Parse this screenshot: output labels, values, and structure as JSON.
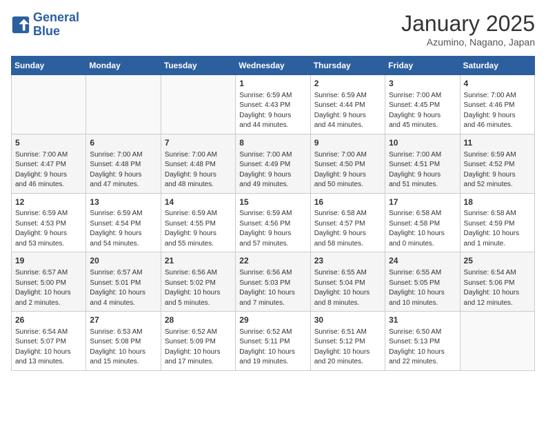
{
  "logo": {
    "line1": "General",
    "line2": "Blue"
  },
  "title": "January 2025",
  "subtitle": "Azumino, Nagano, Japan",
  "days_of_week": [
    "Sunday",
    "Monday",
    "Tuesday",
    "Wednesday",
    "Thursday",
    "Friday",
    "Saturday"
  ],
  "weeks": [
    [
      {
        "day": "",
        "info": ""
      },
      {
        "day": "",
        "info": ""
      },
      {
        "day": "",
        "info": ""
      },
      {
        "day": "1",
        "info": "Sunrise: 6:59 AM\nSunset: 4:43 PM\nDaylight: 9 hours\nand 44 minutes."
      },
      {
        "day": "2",
        "info": "Sunrise: 6:59 AM\nSunset: 4:44 PM\nDaylight: 9 hours\nand 44 minutes."
      },
      {
        "day": "3",
        "info": "Sunrise: 7:00 AM\nSunset: 4:45 PM\nDaylight: 9 hours\nand 45 minutes."
      },
      {
        "day": "4",
        "info": "Sunrise: 7:00 AM\nSunset: 4:46 PM\nDaylight: 9 hours\nand 46 minutes."
      }
    ],
    [
      {
        "day": "5",
        "info": "Sunrise: 7:00 AM\nSunset: 4:47 PM\nDaylight: 9 hours\nand 46 minutes."
      },
      {
        "day": "6",
        "info": "Sunrise: 7:00 AM\nSunset: 4:48 PM\nDaylight: 9 hours\nand 47 minutes."
      },
      {
        "day": "7",
        "info": "Sunrise: 7:00 AM\nSunset: 4:48 PM\nDaylight: 9 hours\nand 48 minutes."
      },
      {
        "day": "8",
        "info": "Sunrise: 7:00 AM\nSunset: 4:49 PM\nDaylight: 9 hours\nand 49 minutes."
      },
      {
        "day": "9",
        "info": "Sunrise: 7:00 AM\nSunset: 4:50 PM\nDaylight: 9 hours\nand 50 minutes."
      },
      {
        "day": "10",
        "info": "Sunrise: 7:00 AM\nSunset: 4:51 PM\nDaylight: 9 hours\nand 51 minutes."
      },
      {
        "day": "11",
        "info": "Sunrise: 6:59 AM\nSunset: 4:52 PM\nDaylight: 9 hours\nand 52 minutes."
      }
    ],
    [
      {
        "day": "12",
        "info": "Sunrise: 6:59 AM\nSunset: 4:53 PM\nDaylight: 9 hours\nand 53 minutes."
      },
      {
        "day": "13",
        "info": "Sunrise: 6:59 AM\nSunset: 4:54 PM\nDaylight: 9 hours\nand 54 minutes."
      },
      {
        "day": "14",
        "info": "Sunrise: 6:59 AM\nSunset: 4:55 PM\nDaylight: 9 hours\nand 55 minutes."
      },
      {
        "day": "15",
        "info": "Sunrise: 6:59 AM\nSunset: 4:56 PM\nDaylight: 9 hours\nand 57 minutes."
      },
      {
        "day": "16",
        "info": "Sunrise: 6:58 AM\nSunset: 4:57 PM\nDaylight: 9 hours\nand 58 minutes."
      },
      {
        "day": "17",
        "info": "Sunrise: 6:58 AM\nSunset: 4:58 PM\nDaylight: 10 hours\nand 0 minutes."
      },
      {
        "day": "18",
        "info": "Sunrise: 6:58 AM\nSunset: 4:59 PM\nDaylight: 10 hours\nand 1 minute."
      }
    ],
    [
      {
        "day": "19",
        "info": "Sunrise: 6:57 AM\nSunset: 5:00 PM\nDaylight: 10 hours\nand 2 minutes."
      },
      {
        "day": "20",
        "info": "Sunrise: 6:57 AM\nSunset: 5:01 PM\nDaylight: 10 hours\nand 4 minutes."
      },
      {
        "day": "21",
        "info": "Sunrise: 6:56 AM\nSunset: 5:02 PM\nDaylight: 10 hours\nand 5 minutes."
      },
      {
        "day": "22",
        "info": "Sunrise: 6:56 AM\nSunset: 5:03 PM\nDaylight: 10 hours\nand 7 minutes."
      },
      {
        "day": "23",
        "info": "Sunrise: 6:55 AM\nSunset: 5:04 PM\nDaylight: 10 hours\nand 8 minutes."
      },
      {
        "day": "24",
        "info": "Sunrise: 6:55 AM\nSunset: 5:05 PM\nDaylight: 10 hours\nand 10 minutes."
      },
      {
        "day": "25",
        "info": "Sunrise: 6:54 AM\nSunset: 5:06 PM\nDaylight: 10 hours\nand 12 minutes."
      }
    ],
    [
      {
        "day": "26",
        "info": "Sunrise: 6:54 AM\nSunset: 5:07 PM\nDaylight: 10 hours\nand 13 minutes."
      },
      {
        "day": "27",
        "info": "Sunrise: 6:53 AM\nSunset: 5:08 PM\nDaylight: 10 hours\nand 15 minutes."
      },
      {
        "day": "28",
        "info": "Sunrise: 6:52 AM\nSunset: 5:09 PM\nDaylight: 10 hours\nand 17 minutes."
      },
      {
        "day": "29",
        "info": "Sunrise: 6:52 AM\nSunset: 5:11 PM\nDaylight: 10 hours\nand 19 minutes."
      },
      {
        "day": "30",
        "info": "Sunrise: 6:51 AM\nSunset: 5:12 PM\nDaylight: 10 hours\nand 20 minutes."
      },
      {
        "day": "31",
        "info": "Sunrise: 6:50 AM\nSunset: 5:13 PM\nDaylight: 10 hours\nand 22 minutes."
      },
      {
        "day": "",
        "info": ""
      }
    ]
  ]
}
